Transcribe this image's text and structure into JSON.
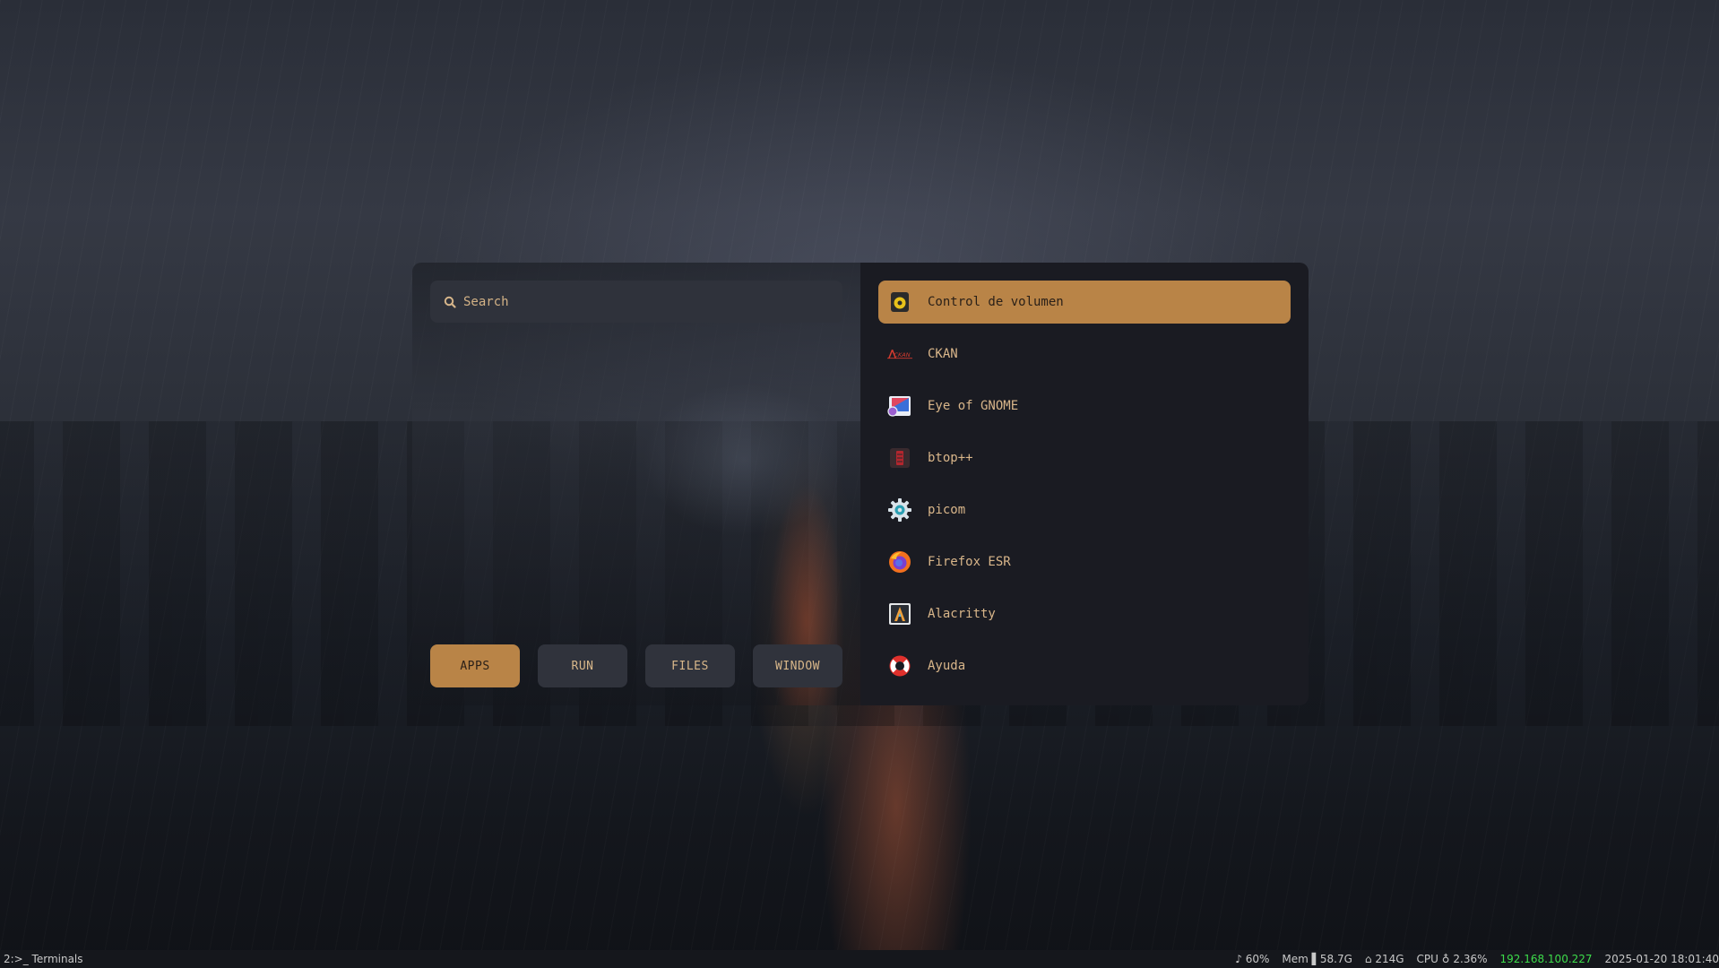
{
  "launcher": {
    "search": {
      "placeholder": "Search",
      "value": ""
    },
    "modes": [
      {
        "label": "APPS",
        "active": true
      },
      {
        "label": "RUN",
        "active": false
      },
      {
        "label": "FILES",
        "active": false
      },
      {
        "label": "WINDOW",
        "active": false
      }
    ],
    "apps": [
      {
        "label": "Control de volumen",
        "icon": "speaker-icon",
        "selected": true
      },
      {
        "label": "CKAN",
        "icon": "ckan-icon",
        "selected": false
      },
      {
        "label": "Eye of GNOME",
        "icon": "image-viewer-icon",
        "selected": false
      },
      {
        "label": "btop++",
        "icon": "btop-icon",
        "selected": false
      },
      {
        "label": "picom",
        "icon": "gear-icon",
        "selected": false
      },
      {
        "label": "Firefox ESR",
        "icon": "firefox-icon",
        "selected": false
      },
      {
        "label": "Alacritty",
        "icon": "terminal-icon",
        "selected": false
      },
      {
        "label": "Ayuda",
        "icon": "lifebuoy-icon",
        "selected": false
      }
    ]
  },
  "statusbar": {
    "workspace": "2:>_ Terminals",
    "volume": "♪ 60%",
    "memory": "Mem ▌58.7G",
    "disk": "⌂ 214G",
    "cpu": "CPU ♁ 2.36%",
    "ip": "192.168.100.227",
    "datetime": "2025-01-20 18:01:40"
  },
  "colors": {
    "accent": "#b98447",
    "accent_text": "#d9b68a",
    "panel": "#1a1b22",
    "ip_green": "#3ddc4a"
  }
}
